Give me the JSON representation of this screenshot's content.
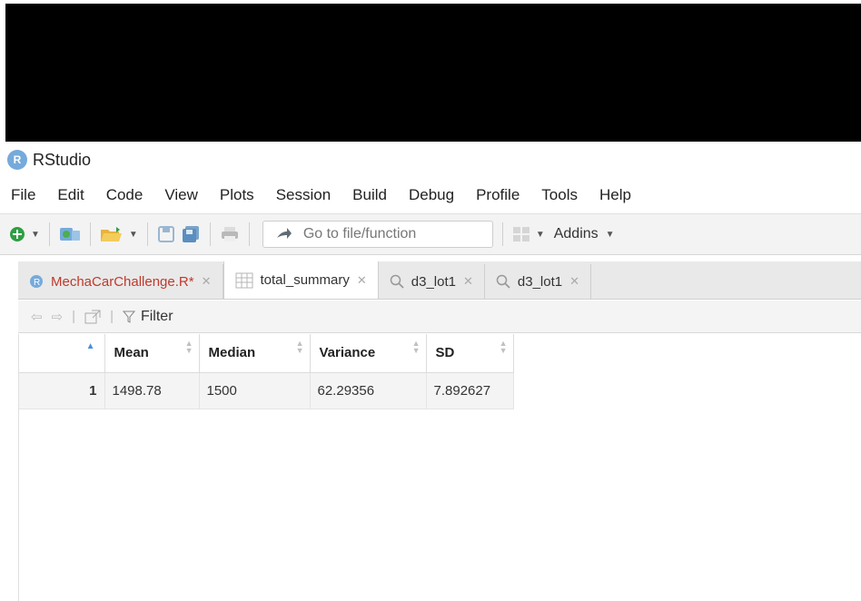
{
  "window": {
    "title": "RStudio"
  },
  "menu": [
    "File",
    "Edit",
    "Code",
    "View",
    "Plots",
    "Session",
    "Build",
    "Debug",
    "Profile",
    "Tools",
    "Help"
  ],
  "toolbar": {
    "goto_placeholder": "Go to file/function",
    "addins_label": "Addins"
  },
  "tabs": [
    {
      "label": "MechaCarChallenge.R*",
      "icon": "r-script-icon"
    },
    {
      "label": "total_summary",
      "icon": "table-icon"
    },
    {
      "label": "d3_lot1",
      "icon": "magnifier-icon"
    },
    {
      "label": "d3_lot1",
      "icon": "magnifier-icon"
    }
  ],
  "viewer": {
    "filter_label": "Filter"
  },
  "table": {
    "columns": [
      "Mean",
      "Median",
      "Variance",
      "SD"
    ],
    "rows": [
      {
        "index": "1",
        "cells": [
          "1498.78",
          "1500",
          "62.29356",
          "7.892627"
        ]
      }
    ]
  },
  "colors": {
    "accent": "#75aadb",
    "modified_tab": "#c0392b",
    "sort_active": "#4a90d9"
  }
}
